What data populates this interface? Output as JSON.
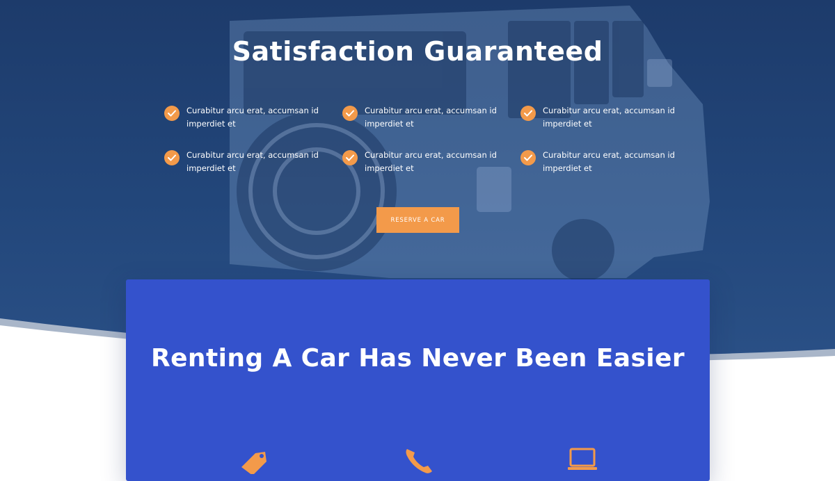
{
  "hero": {
    "title": "Satisfaction Guaranteed",
    "features": [
      {
        "text": "Curabitur arcu erat, accumsan id imperdiet et"
      },
      {
        "text": "Curabitur arcu erat, accumsan id imperdiet et"
      },
      {
        "text": "Curabitur arcu erat, accumsan id imperdiet et"
      },
      {
        "text": "Curabitur arcu erat, accumsan id imperdiet et"
      },
      {
        "text": "Curabitur arcu erat, accumsan id imperdiet et"
      },
      {
        "text": "Curabitur arcu erat, accumsan id imperdiet et"
      }
    ],
    "feature_icon": "check-circle-icon",
    "cta_label": "RESERVE A CAR",
    "background_image": "jeep-rear-view-photo"
  },
  "card": {
    "title": "Renting A Car Has Never Been Easier",
    "icons": [
      "price-tag-icon",
      "phone-icon",
      "laptop-icon"
    ]
  },
  "colors": {
    "hero_overlay": "#1f3d6e",
    "accent": "#f39a4a",
    "card_bg": "#3452cc",
    "text": "#ffffff"
  }
}
